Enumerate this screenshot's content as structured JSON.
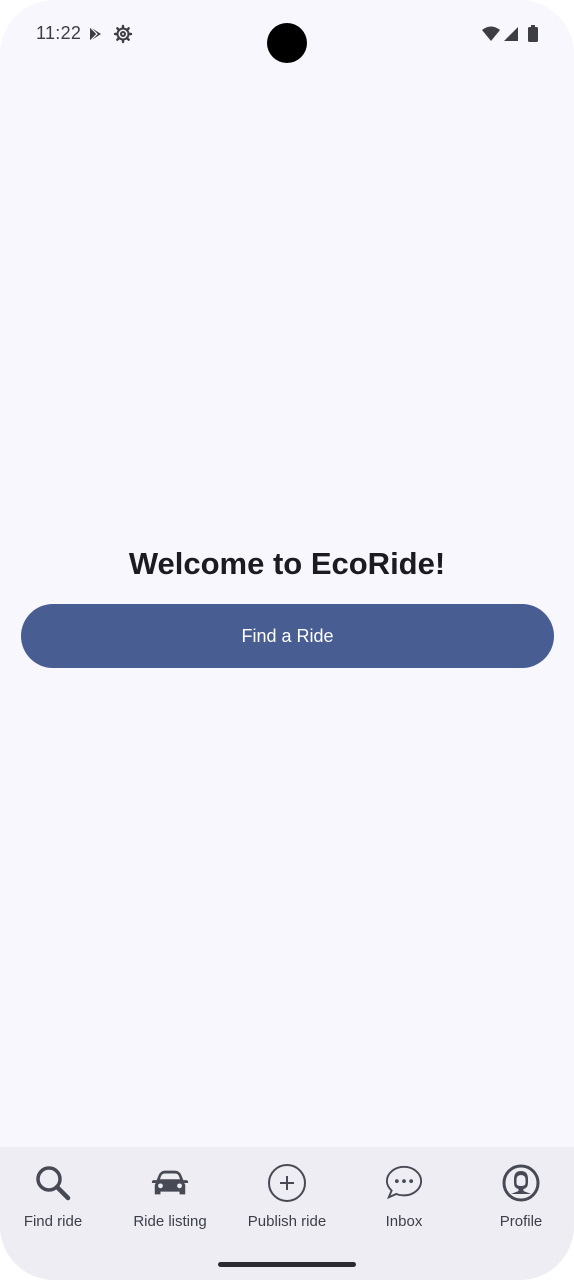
{
  "status_bar": {
    "time": "11:22",
    "icons_left": [
      "play-store-icon",
      "settings-gear-icon"
    ],
    "icons_right": [
      "wifi-icon",
      "cell-signal-icon",
      "battery-icon"
    ]
  },
  "main": {
    "welcome_text": "Welcome to EcoRide!",
    "cta_label": "Find a Ride"
  },
  "bottom_nav": {
    "items": [
      {
        "label": "Find ride",
        "icon": "search-icon"
      },
      {
        "label": "Ride listing",
        "icon": "car-icon"
      },
      {
        "label": "Publish ride",
        "icon": "add-circle-icon"
      },
      {
        "label": "Inbox",
        "icon": "chat-bubble-icon"
      },
      {
        "label": "Profile",
        "icon": "profile-icon"
      }
    ]
  },
  "colors": {
    "background": "#f8f7fd",
    "primary": "#485d92",
    "nav_background": "#eeedf4",
    "text_dark": "#1b1b21",
    "icon_color": "#474a55"
  }
}
